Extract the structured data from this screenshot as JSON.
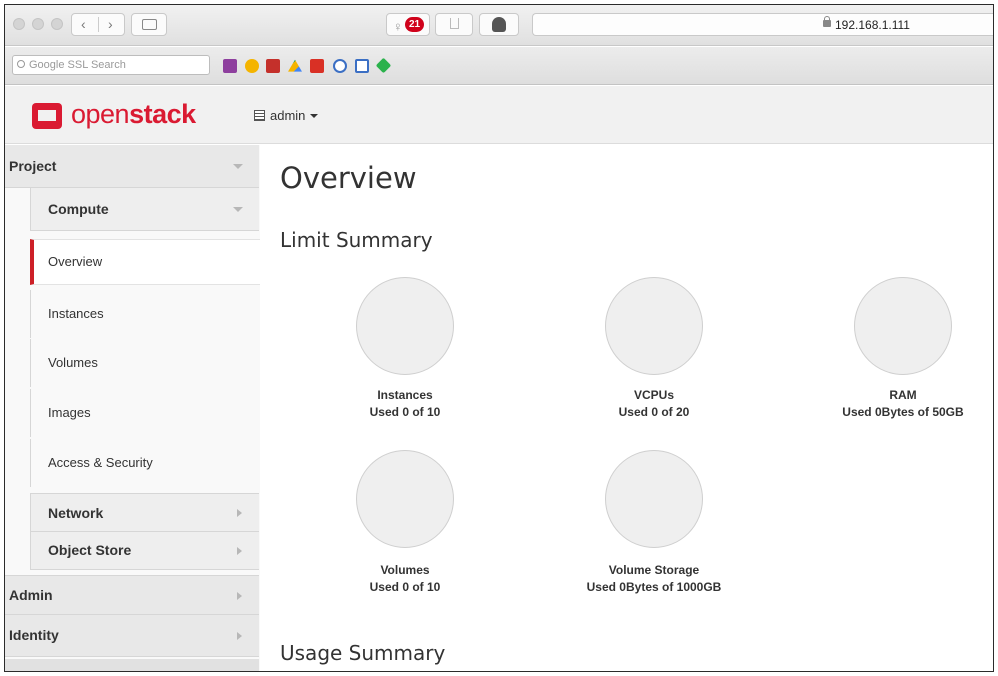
{
  "browser": {
    "notification_count": "21",
    "address": "192.168.1.111",
    "search_placeholder": "Google SSL Search"
  },
  "header": {
    "logo_open": "open",
    "logo_stack": "stack",
    "project": "admin"
  },
  "sidebar": {
    "project": "Project",
    "compute": "Compute",
    "items": [
      "Overview",
      "Instances",
      "Volumes",
      "Images",
      "Access & Security"
    ],
    "network": "Network",
    "object_store": "Object Store",
    "admin": "Admin",
    "identity": "Identity"
  },
  "main": {
    "title": "Overview",
    "limit_summary": "Limit Summary",
    "usage_summary": "Usage Summary",
    "limits": [
      {
        "name": "Instances",
        "usage": "Used 0 of 10"
      },
      {
        "name": "VCPUs",
        "usage": "Used 0 of 20"
      },
      {
        "name": "RAM",
        "usage": "Used 0Bytes of 50GB"
      },
      {
        "name": "Volumes",
        "usage": "Used 0 of 10"
      },
      {
        "name": "Volume Storage",
        "usage": "Used 0Bytes of 1000GB"
      }
    ]
  },
  "colors": {
    "brand": "#da1a32",
    "active_marker": "#cd2027",
    "notification_badge": "#d0021b"
  },
  "icons": {
    "bookmarks": [
      "calendar-icon",
      "contacts-icon",
      "youtube-icon",
      "drive-icon",
      "gmail-icon",
      "whatsapp-icon",
      "window-icon",
      "feedly-icon"
    ]
  }
}
